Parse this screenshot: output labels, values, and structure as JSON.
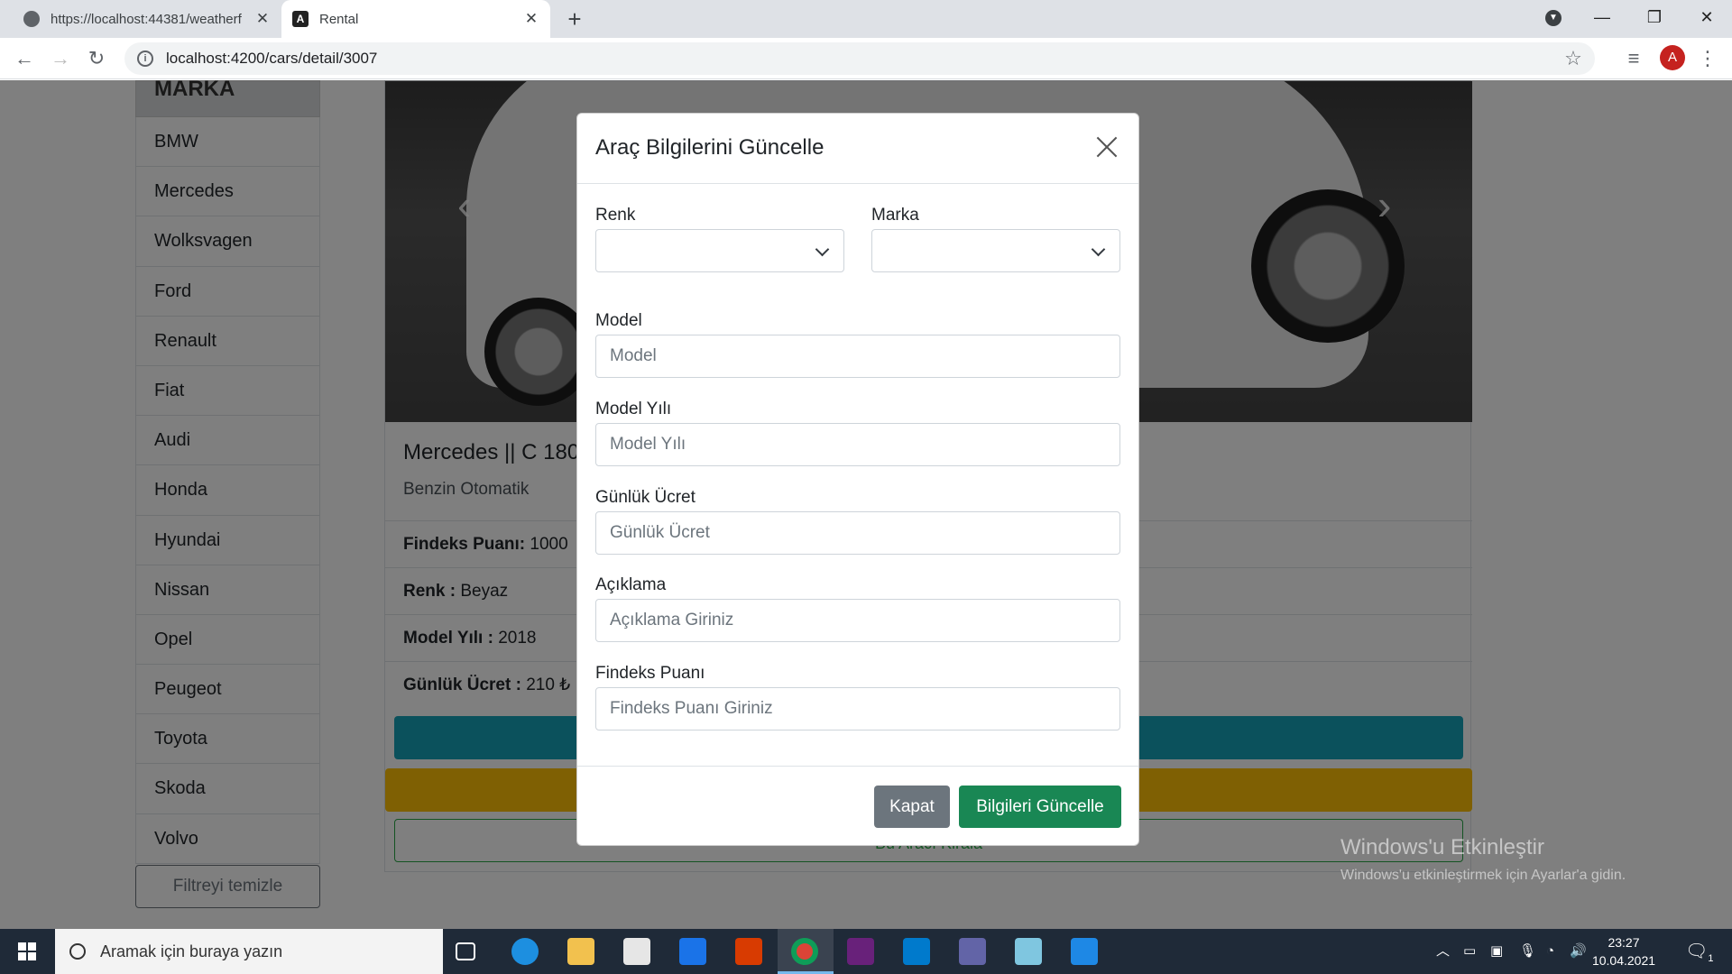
{
  "browser": {
    "tabs": [
      {
        "title": "https://localhost:44381/weatherf",
        "active": false
      },
      {
        "title": "Rental",
        "active": true
      }
    ],
    "url": "localhost:4200/cars/detail/3007",
    "profile_initial": "A"
  },
  "sidebar": {
    "header": "MARKA",
    "brands": [
      "BMW",
      "Mercedes",
      "Wolksvagen",
      "Ford",
      "Renault",
      "Fiat",
      "Audi",
      "Honda",
      "Hyundai",
      "Nissan",
      "Opel",
      "Peugeot",
      "Toyota",
      "Skoda",
      "Volvo"
    ],
    "clear_filter": "Filtreyi temizle"
  },
  "car": {
    "title": "Mercedes || C 180",
    "subtitle": "Benzin Otomatik",
    "details": [
      {
        "label": "Findeks Puanı:",
        "value": "1000"
      },
      {
        "label": "Renk :",
        "value": "Beyaz"
      },
      {
        "label": "Model Yılı :",
        "value": "2018"
      },
      {
        "label": "Günlük Ücret :",
        "value": "210 ₺"
      }
    ],
    "rent_button": "Bu Aracı Kirala"
  },
  "modal": {
    "title": "Araç Bilgilerini Güncelle",
    "fields": {
      "color": {
        "label": "Renk",
        "value": ""
      },
      "brand": {
        "label": "Marka",
        "value": ""
      },
      "model": {
        "label": "Model",
        "placeholder": "Model"
      },
      "model_year": {
        "label": "Model Yılı",
        "placeholder": "Model Yılı"
      },
      "daily_price": {
        "label": "Günlük Ücret",
        "placeholder": "Günlük Ücret"
      },
      "description": {
        "label": "Açıklama",
        "placeholder": "Açıklama Giriniz"
      },
      "findeks": {
        "label": "Findeks Puanı",
        "placeholder": "Findeks Puanı Giriniz"
      }
    },
    "close_button": "Kapat",
    "update_button": "Bilgileri Güncelle"
  },
  "watermark": {
    "line1": "Windows'u Etkinleştir",
    "line2": "Windows'u etkinleştirmek için Ayarlar'a gidin."
  },
  "taskbar": {
    "search_placeholder": "Aramak için buraya yazın",
    "time": "23:27",
    "date": "10.04.2021",
    "notification_count": "1"
  },
  "colors": {
    "teal": "#17a2b8",
    "yellow": "#ffc107",
    "success": "#198754",
    "secondary": "#6c757d"
  }
}
